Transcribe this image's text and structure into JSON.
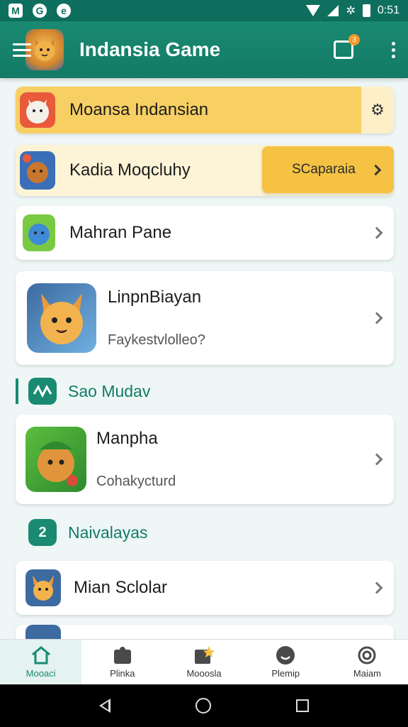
{
  "status_bar": {
    "time": "0:51",
    "left_icons": [
      "gmail-icon",
      "app-icon",
      "app-icon"
    ]
  },
  "app_bar": {
    "title": "Indansia Game",
    "chat_badge_count": "3"
  },
  "cards": [
    {
      "label": "Moansa Indansian"
    },
    {
      "label": "Kadia Moqcluhy",
      "action_label": "SCaparaia"
    },
    {
      "label": "Mahran Pane"
    },
    {
      "title": "LinpnBiayan",
      "subtitle": "Faykestvlolleo?"
    },
    {
      "title": "Manpha",
      "subtitle": "Cohakycturd"
    },
    {
      "label": "Mian Sclolar"
    }
  ],
  "sections": [
    {
      "title": "Sao Mudav",
      "icon": "wave-icon"
    },
    {
      "title": "Naivalayas",
      "icon_text": "2"
    }
  ],
  "bottom_nav": [
    {
      "label": "Mooaci",
      "icon": "home-icon",
      "active": true
    },
    {
      "label": "Plinka",
      "icon": "puzzle-icon",
      "active": false
    },
    {
      "label": "Mooosla",
      "icon": "folder-star-icon",
      "active": false
    },
    {
      "label": "Plemip",
      "icon": "smile-icon",
      "active": false
    },
    {
      "label": "Maiam",
      "icon": "swirl-icon",
      "active": false
    }
  ],
  "colors": {
    "primary": "#1a8a72",
    "highlight": "#f7cf63",
    "accent": "#f5c244"
  }
}
